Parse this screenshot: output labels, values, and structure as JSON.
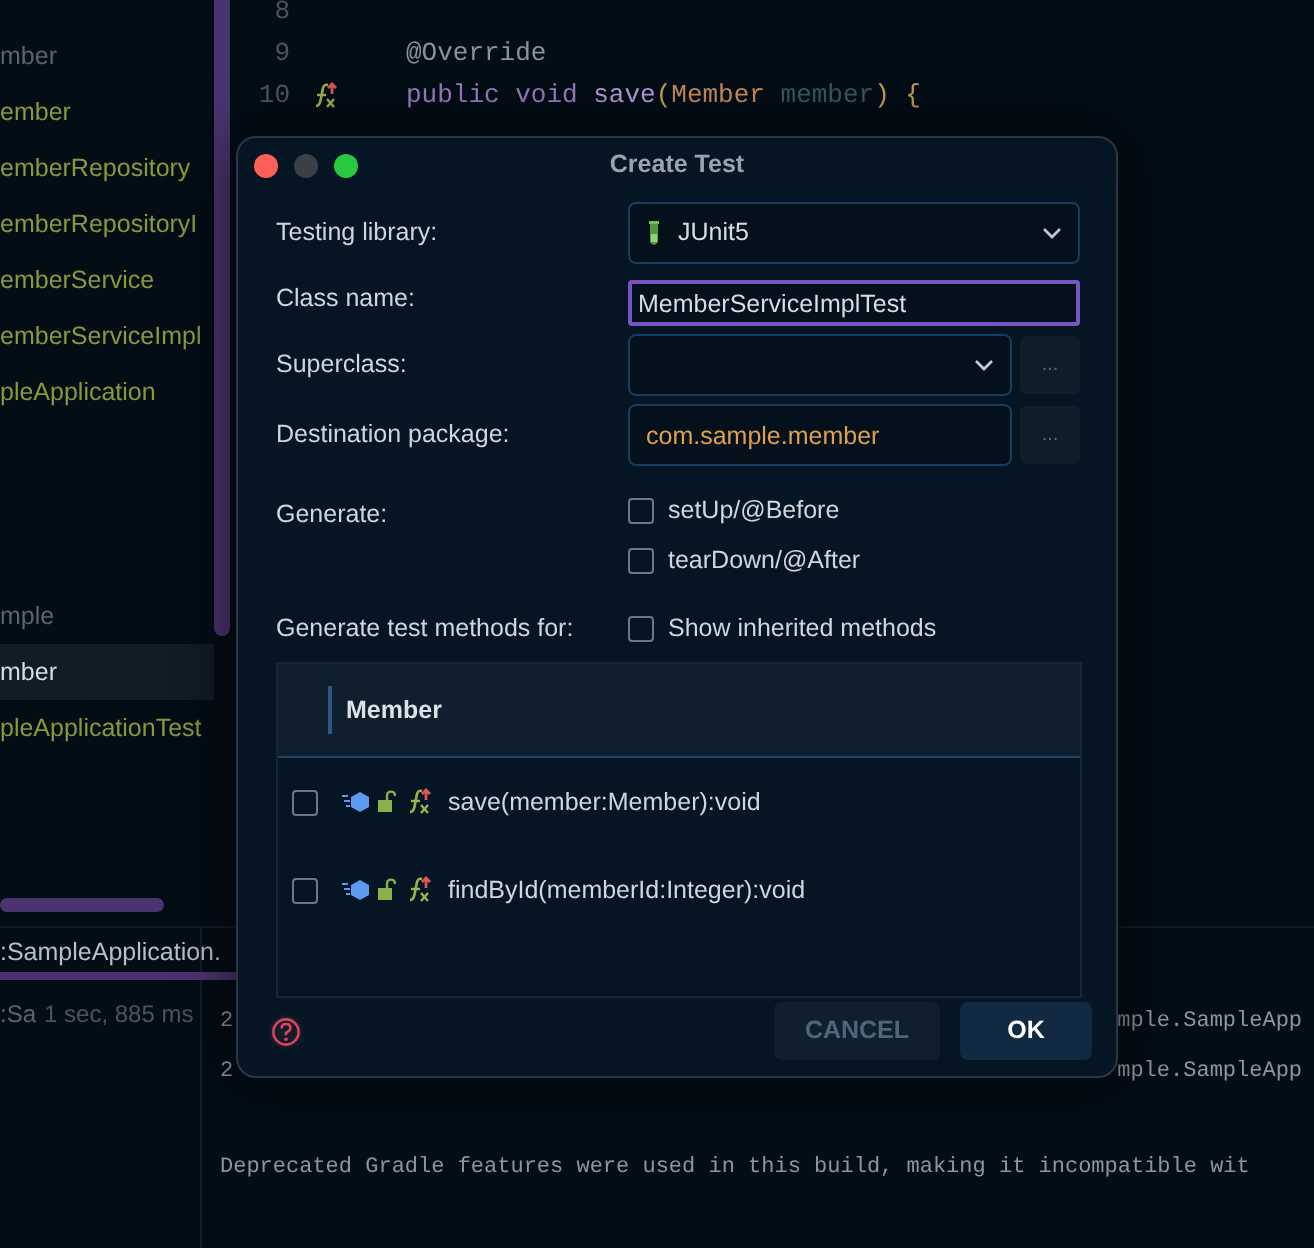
{
  "project_tree": {
    "source_items": [
      {
        "label": "mber",
        "kind": "package",
        "selected": false
      },
      {
        "label": "ember",
        "kind": "class",
        "selected": false
      },
      {
        "label": "emberRepository",
        "kind": "class",
        "selected": false
      },
      {
        "label": "emberRepositoryI",
        "kind": "class",
        "selected": false
      },
      {
        "label": "emberService",
        "kind": "class",
        "selected": false
      },
      {
        "label": "emberServiceImpl",
        "kind": "class",
        "selected": false
      },
      {
        "label": "pleApplication",
        "kind": "class",
        "selected": false
      }
    ],
    "test_items": [
      {
        "label": "mple",
        "kind": "package",
        "selected": false
      },
      {
        "label": "mber",
        "kind": "package",
        "selected": true
      },
      {
        "label": "pleApplicationTest",
        "kind": "class",
        "selected": false
      }
    ]
  },
  "editor": {
    "lines": [
      {
        "number": "8"
      },
      {
        "number": "9",
        "tokens": [
          {
            "text": "@Override",
            "kind": "annotation"
          }
        ]
      },
      {
        "number": "10",
        "gutter_icon": true,
        "tokens": [
          {
            "text": "public void ",
            "kind": "keyword"
          },
          {
            "text": "save",
            "kind": "method"
          },
          {
            "text": "(",
            "kind": "paren"
          },
          {
            "text": "Member ",
            "kind": "type"
          },
          {
            "text": "member",
            "kind": "param"
          },
          {
            "text": ") {",
            "kind": "paren"
          }
        ]
      }
    ]
  },
  "run_panel": {
    "tabs": [
      {
        "label": ":SampleApplication.",
        "selected": true
      }
    ],
    "tree": [
      {
        "label": ":Sa",
        "time": "1 sec, 885 ms"
      }
    ],
    "console": [
      {
        "prefix": "2",
        "suffix": "mple.SampleApp"
      },
      {
        "prefix": "2",
        "suffix": "mple.SampleApp"
      },
      {
        "text": "Deprecated Gradle features were used in this build, making it incompatible wit"
      }
    ]
  },
  "dialog": {
    "title": "Create Test",
    "testing_library": {
      "label": "Testing library:",
      "value": "JUnit5"
    },
    "class_name": {
      "label": "Class name:",
      "value": "MemberServiceImplTest"
    },
    "superclass": {
      "label": "Superclass:",
      "browse": "..."
    },
    "destination_package": {
      "label": "Destination package:",
      "value": "com.sample.member",
      "browse": "..."
    },
    "generate": {
      "label": "Generate:",
      "options": [
        {
          "label": "setUp/@Before",
          "checked": false
        },
        {
          "label": "tearDown/@After",
          "checked": false
        }
      ]
    },
    "methods_for": {
      "label": "Generate test methods for:",
      "show_inherited": {
        "label": "Show inherited methods",
        "checked": false
      }
    },
    "member_table": {
      "header": "Member",
      "rows": [
        {
          "signature": "save(member:Member):void",
          "checked": false
        },
        {
          "signature": "findById(memberId:Integer):void",
          "checked": false
        }
      ]
    },
    "buttons": [
      {
        "label": "CANCEL",
        "kind": "secondary"
      },
      {
        "label": "OK",
        "kind": "primary"
      }
    ]
  }
}
